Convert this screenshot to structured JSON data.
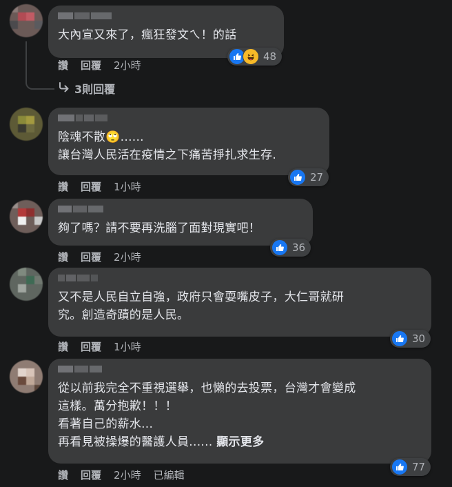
{
  "comments": [
    {
      "text": "大內宣又來了，瘋狂發文ㄟ！的話",
      "actions": {
        "like": "讚",
        "reply": "回覆",
        "time": "2小時"
      },
      "reactions": {
        "count": "48",
        "icons": [
          "like-icon",
          "haha-icon"
        ]
      },
      "replies_label": "3則回覆"
    },
    {
      "text": "陰魂不散🙄......\n讓台灣人民活在疫情之下痛苦掙扎求生存.",
      "actions": {
        "like": "讚",
        "reply": "回覆",
        "time": "1小時"
      },
      "reactions": {
        "count": "27",
        "icons": [
          "like-icon"
        ]
      }
    },
    {
      "text": "夠了嗎？請不要再洗腦了面對現實吧！",
      "actions": {
        "like": "讚",
        "reply": "回覆",
        "time": "2小時"
      },
      "reactions": {
        "count": "36",
        "icons": [
          "like-icon"
        ]
      }
    },
    {
      "text": "又不是人民自立自強，政府只會耍嘴皮子，大仁哥就研\n究。創造奇蹟的是人民。",
      "actions": {
        "like": "讚",
        "reply": "回覆",
        "time": "1小時"
      },
      "reactions": {
        "count": "30",
        "icons": [
          "like-icon"
        ]
      }
    },
    {
      "text": "從以前我完全不重視選舉，也懶的去投票，台灣才會變成\n這樣。萬分抱歉！！！\n看著自己的薪水...\n再看見被操爆的醫護人員......",
      "see_more": "顯示更多",
      "actions": {
        "like": "讚",
        "reply": "回覆",
        "time": "2小時",
        "edited": "已編輯"
      },
      "reactions": {
        "count": "77",
        "icons": [
          "like-icon"
        ]
      }
    }
  ],
  "colors": {
    "background": "#18191a",
    "bubble": "#3a3b3c",
    "text": "#e4e6eb",
    "secondary_text": "#b0b3b8",
    "like_blue": "#1877f2",
    "haha_yellow": "#f7b928"
  }
}
